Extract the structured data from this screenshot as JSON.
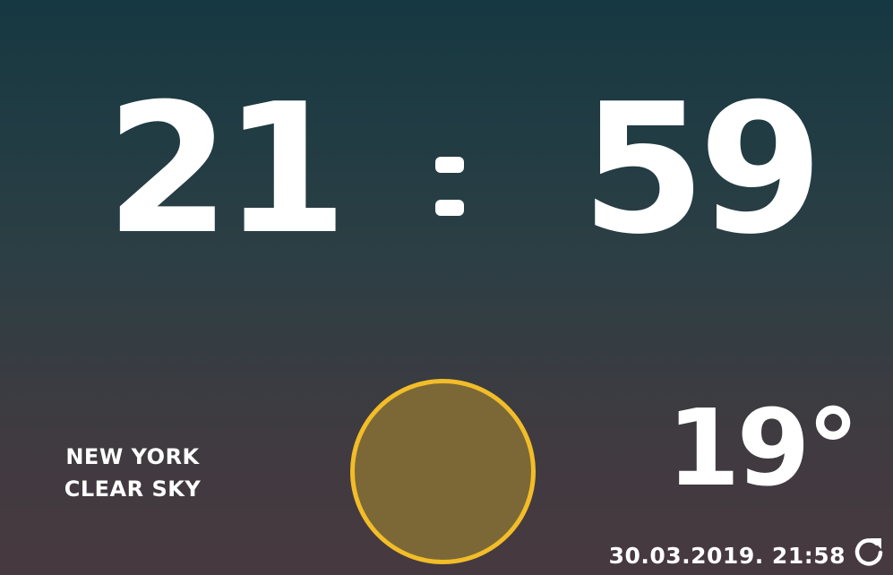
{
  "clock": {
    "hours": "21",
    "minutes": "59"
  },
  "weather": {
    "city": "NEW YORK",
    "condition": "CLEAR SKY",
    "temperature": "19°",
    "icon": "sun-icon"
  },
  "footer": {
    "updated": "30.03.2019. 21:58",
    "refresh_icon": "refresh-icon"
  },
  "colors": {
    "sun_fill": "#7c6837",
    "sun_border": "#f2bd28",
    "text": "#ffffff"
  }
}
